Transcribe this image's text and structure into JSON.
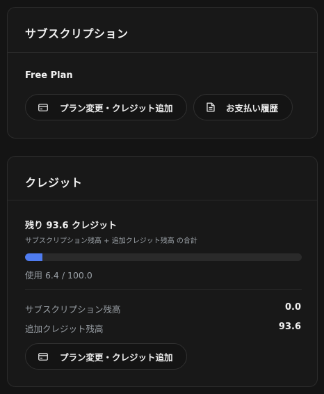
{
  "subscription": {
    "title": "サブスクリプション",
    "plan_name": "Free Plan",
    "change_button_label": "プラン変更・クレジット追加",
    "history_button_label": "お支払い履歴"
  },
  "credits": {
    "title": "クレジット",
    "remaining_text": "残り 93.6 クレジット",
    "note": "サブスクリプション残高 + 追加クレジット残高 の合計",
    "usage_text": "使用 6.4 / 100.0",
    "usage_fraction": 0.064,
    "rows": [
      {
        "label": "サブスクリプション残高",
        "value": "0.0"
      },
      {
        "label": "追加クレジット残高",
        "value": "93.6"
      }
    ],
    "change_button_label": "プラン変更・クレジット追加"
  },
  "colors": {
    "accent": "#4f7cf0",
    "background": "#141414",
    "card": "#181818"
  },
  "icons": {
    "change_button": "credit-card-icon",
    "history_button": "document-icon"
  }
}
